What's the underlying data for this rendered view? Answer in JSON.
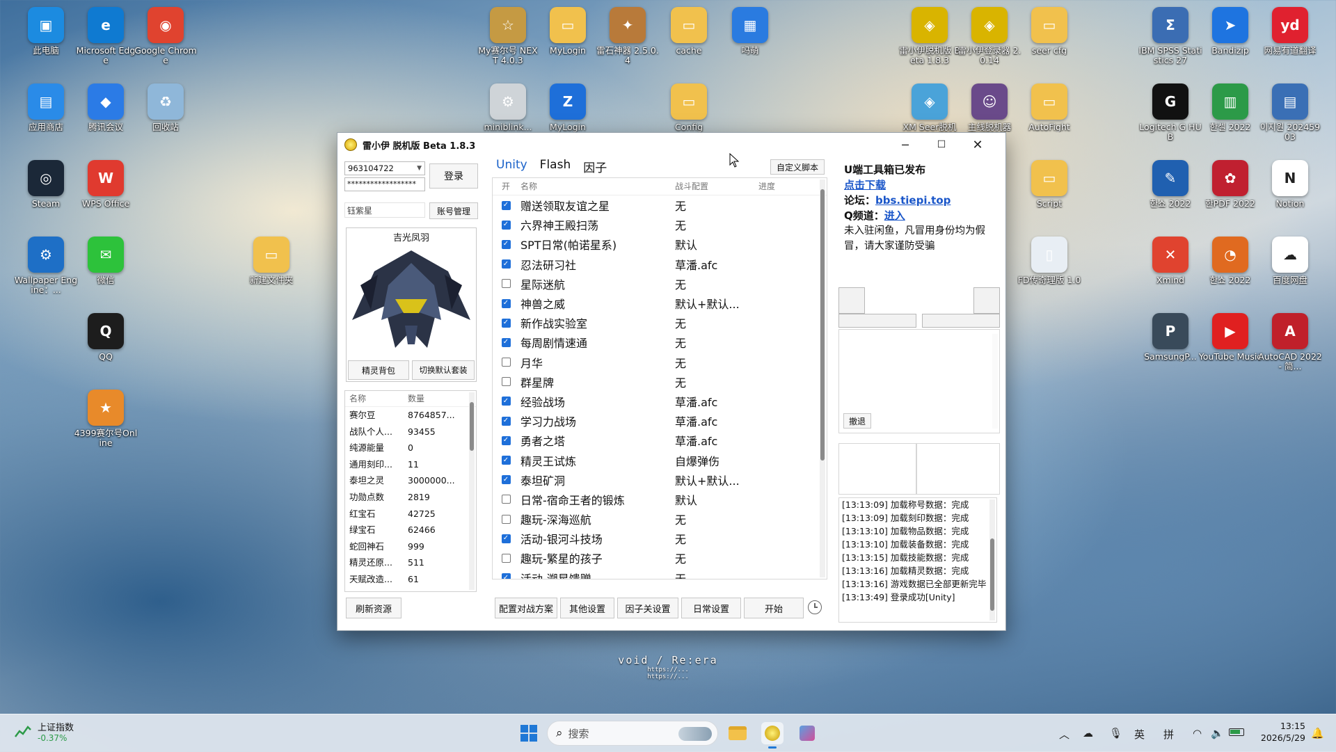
{
  "desktop": {
    "icons": [
      {
        "label": "此电脑",
        "color": "#1c8be0",
        "glyph": "▣"
      },
      {
        "label": "Microsoft Edge",
        "color": "#0f7ad1",
        "glyph": "e"
      },
      {
        "label": "Google Chrome",
        "color": "#e0432f",
        "glyph": "◉"
      },
      {
        "label": "应用商店",
        "color": "#2a8be8",
        "glyph": "▤"
      },
      {
        "label": "腾讯会议",
        "color": "#2b7be6",
        "glyph": "◆"
      },
      {
        "label": "回收站",
        "color": "#8fb7d9",
        "glyph": "♻"
      },
      {
        "label": "Steam",
        "color": "#1b2838",
        "glyph": "◎"
      },
      {
        "label": "WPS Office",
        "color": "#e03a2f",
        "glyph": "W"
      },
      {
        "label": "Wallpaper Engine：...",
        "color": "#1e6fc6",
        "glyph": "⚙"
      },
      {
        "label": "微信",
        "color": "#2dc23b",
        "glyph": "✉"
      },
      {
        "label": "新建文件夹",
        "color": "#f1c14d",
        "glyph": "▭"
      },
      {
        "label": "QQ",
        "color": "#1d1d1d",
        "glyph": "Q"
      },
      {
        "label": "4399赛尔号Online",
        "color": "#e88a2a",
        "glyph": "★"
      },
      {
        "label": "My赛尔号 NEXT 4.0.3",
        "color": "#c59a43",
        "glyph": "☆"
      },
      {
        "label": "MyLogin",
        "color": "#f1c14d",
        "glyph": "▭"
      },
      {
        "label": "雷石神器 2.5.0.4",
        "color": "#b87a3a",
        "glyph": "✦"
      },
      {
        "label": "cache",
        "color": "#f1c14d",
        "glyph": "▭"
      },
      {
        "label": "吗萌",
        "color": "#2a7be0",
        "glyph": "▦"
      },
      {
        "label": "miniblink...",
        "color": "#cfd4d8",
        "glyph": "⚙"
      },
      {
        "label": "MyLogin",
        "color": "#1e6fd9",
        "glyph": "Z"
      },
      {
        "label": "Config",
        "color": "#f1c14d",
        "glyph": "▭"
      },
      {
        "label": "雷小伊脱机版 Beta 1.8.3",
        "color": "#d9b400",
        "glyph": "◈"
      },
      {
        "label": "雷小伊登录器 2.0.14",
        "color": "#d9b400",
        "glyph": "◈"
      },
      {
        "label": "seer cfg",
        "color": "#f1c14d",
        "glyph": "▭"
      },
      {
        "label": "XM Seer脱机",
        "color": "#4aa3d9",
        "glyph": "◈"
      },
      {
        "label": "主线脱机器",
        "color": "#6a4a8a",
        "glyph": "☺"
      },
      {
        "label": "AutoFight",
        "color": "#f1c14d",
        "glyph": "▭"
      },
      {
        "label": "IBM SPSS Statistics 27",
        "color": "#3b6db3",
        "glyph": "Σ"
      },
      {
        "label": "Bandizip",
        "color": "#1e74e0",
        "glyph": "➤"
      },
      {
        "label": "网易有道翻译",
        "color": "#e0212f",
        "glyph": "yd"
      },
      {
        "label": "Logitech G HUB",
        "color": "#111111",
        "glyph": "G"
      },
      {
        "label": "한셀 2022",
        "color": "#2c9a48",
        "glyph": "▥"
      },
      {
        "label": "이지원 20245903",
        "color": "#3a6fb5",
        "glyph": "▤"
      },
      {
        "label": "Script",
        "color": "#f1c14d",
        "glyph": "▭"
      },
      {
        "label": "한쇼 2022",
        "color": "#2060b0",
        "glyph": "✎"
      },
      {
        "label": "한PDF 2022",
        "color": "#c02030",
        "glyph": "✿"
      },
      {
        "label": "Notion",
        "color": "#ffffff",
        "glyph": "N"
      },
      {
        "label": "FD传奇理版 1.0",
        "color": "#e8eef4",
        "glyph": "▯"
      },
      {
        "label": "Xmind",
        "color": "#e0432f",
        "glyph": "✕"
      },
      {
        "label": "한쇼 2022",
        "color": "#e06a20",
        "glyph": "◔"
      },
      {
        "label": "百度网盘",
        "color": "#ffffff",
        "glyph": "☁"
      },
      {
        "label": "SamsungP...",
        "color": "#394a5a",
        "glyph": "P"
      },
      {
        "label": "YouTube Music",
        "color": "#e02020",
        "glyph": "▶"
      },
      {
        "label": "AutoCAD 2022 - 简...",
        "color": "#c0202a",
        "glyph": "A"
      }
    ]
  },
  "window": {
    "title": "雷小伊 脱机版 Beta 1.8.3",
    "account": "963104722",
    "password": "******************",
    "nickname": "钰紫星",
    "login_button": "登录",
    "account_manage_button": "账号管理",
    "pet_name": "吉光凤羽",
    "pet_bag_button": "精灵背包",
    "switch_suit_button": "切换默认套装",
    "resources_header": {
      "name": "名称",
      "count": "数量"
    },
    "resources": [
      {
        "name": "赛尔豆",
        "count": "8764857..."
      },
      {
        "name": "战队个人...",
        "count": "93455"
      },
      {
        "name": "纯源能量",
        "count": "0"
      },
      {
        "name": "通用刻印...",
        "count": "11"
      },
      {
        "name": "泰坦之灵",
        "count": "3000000..."
      },
      {
        "name": "功勋点数",
        "count": "2819"
      },
      {
        "name": "红宝石",
        "count": "42725"
      },
      {
        "name": "绿宝石",
        "count": "62466"
      },
      {
        "name": "蛇回神石",
        "count": "999"
      },
      {
        "name": "精灵还原...",
        "count": "511"
      },
      {
        "name": "天赋改造...",
        "count": "61"
      }
    ],
    "refresh_button": "刷新资源",
    "tabs": [
      "Unity",
      "Flash",
      "因子"
    ],
    "custom_script_button": "自定义脚本",
    "task_header": {
      "on": "开",
      "name": "名称",
      "config": "战斗配置",
      "progress": "进度"
    },
    "tasks": [
      {
        "on": true,
        "name": "赠送领取友谊之星",
        "config": "无"
      },
      {
        "on": true,
        "name": "六界神王殿扫荡",
        "config": "无"
      },
      {
        "on": true,
        "name": "SPT日常(帕诺星系)",
        "config": "默认"
      },
      {
        "on": true,
        "name": "忍法研习社",
        "config": "草潘.afc"
      },
      {
        "on": false,
        "name": "星际迷航",
        "config": "无"
      },
      {
        "on": true,
        "name": "神兽之威",
        "config": "默认+默认..."
      },
      {
        "on": true,
        "name": "新作战实验室",
        "config": "无"
      },
      {
        "on": true,
        "name": "每周剧情速通",
        "config": "无"
      },
      {
        "on": false,
        "name": "月华",
        "config": "无"
      },
      {
        "on": false,
        "name": "群星牌",
        "config": "无"
      },
      {
        "on": true,
        "name": "经验战场",
        "config": "草潘.afc"
      },
      {
        "on": true,
        "name": "学习力战场",
        "config": "草潘.afc"
      },
      {
        "on": true,
        "name": "勇者之塔",
        "config": "草潘.afc"
      },
      {
        "on": true,
        "name": "精灵王试炼",
        "config": "自爆弹伤"
      },
      {
        "on": true,
        "name": "泰坦矿洞",
        "config": "默认+默认..."
      },
      {
        "on": false,
        "name": "日常-宿命王者的锻炼",
        "config": "默认"
      },
      {
        "on": false,
        "name": "趣玩-深海巡航",
        "config": "无"
      },
      {
        "on": true,
        "name": "活动-银河斗技场",
        "config": "无"
      },
      {
        "on": false,
        "name": "趣玩-繁星的孩子",
        "config": "无"
      },
      {
        "on": true,
        "name": "活动-溯星馈赠",
        "config": "无"
      }
    ],
    "bottom_buttons": [
      "配置对战方案",
      "其他设置",
      "因子关设置",
      "日常设置",
      "开始"
    ],
    "notice": {
      "line1": "U端工具箱已发布",
      "download": "点击下载",
      "forum_label": "论坛：",
      "forum_link": "bbs.tiepi.top",
      "q_label": "Q频道：",
      "q_link": "进入",
      "warning": "未入驻闲鱼，凡冒用身份均为假冒，请大家谨防受骗"
    },
    "withdraw_button": "撤退",
    "log": [
      "[13:13:09] 加载称号数据：完成",
      "[13:13:09] 加载刻印数据：完成",
      "[13:13:10] 加载物品数据：完成",
      "[13:13:10] 加载装备数据：完成",
      "[13:13:15] 加载技能数据：完成",
      "[13:13:16] 加载精灵数据：完成",
      "[13:13:16] 游戏数据已全部更新完毕",
      "[13:13:49] 登录成功[Unity]"
    ]
  },
  "wallpaper_text": {
    "line1": "void / Re:era",
    "line2": "https://...",
    "line3": "https://..."
  },
  "taskbar": {
    "stock_name": "上证指数",
    "stock_change": "-0.37%",
    "search_placeholder": "搜索",
    "ime_lang": "英",
    "ime_mode": "拼",
    "time": "13:15",
    "date": "2026/5/29"
  }
}
